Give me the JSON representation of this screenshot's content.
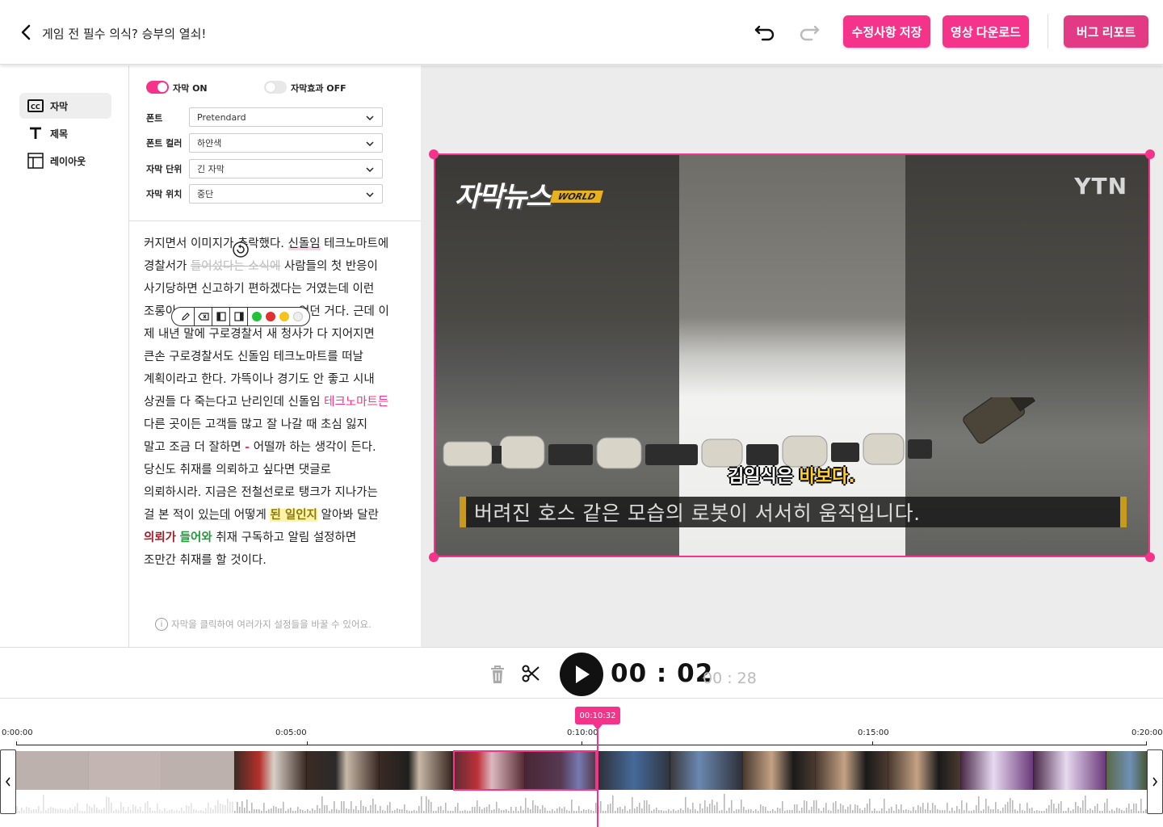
{
  "header": {
    "title": "게임 전 필수 의식? 승부의 열쇠!",
    "save_label": "수정사항 저장",
    "download_label": "영상 다운로드",
    "bug_label": "버그 리포트"
  },
  "sidebar": {
    "items": [
      {
        "label": "자막",
        "icon": "cc-icon"
      },
      {
        "label": "제목",
        "icon": "text-icon"
      },
      {
        "label": "레이아웃",
        "icon": "layout-icon"
      }
    ]
  },
  "settings": {
    "subtitle_toggle_label": "자막 ON",
    "effect_toggle_label": "자막효과 OFF",
    "font_label": "폰트",
    "font_value": "Pretendard",
    "color_label": "폰트 컬러",
    "color_value": "하얀색",
    "unit_label": "자막 단위",
    "unit_value": "긴 자막",
    "position_label": "자막 위치",
    "position_value": "중단"
  },
  "transcript": {
    "l1a": "커지면서 이미지가 추락했다. ",
    "l1b": "신돌임",
    "l1c": " 테크노마트에",
    "l2a": "경찰서가 ",
    "l2b": "들어섰다는 소식에",
    "l2c": " 사람들의 첫 반응이",
    "l3": "사기당하면 신고하기 편하겠다는 거였는데 이런",
    "l4a": "조롱이",
    "l4b": "었던 거다. 근데 이",
    "l5": "제 내년 말에 구로경찰서 새 청사가 다 지어지면",
    "l6": "큰손 구로경찰서도 신돌임 테크노마트를 떠날",
    "l7": "계획이라고 한다. 가뜩이나 경기도 안 좋고 시내",
    "l8a": "상권들 다 죽는다고 난리인데 신돌임 ",
    "l8b": "테크노마트든",
    "l9": "다른 곳이든 고객들 많고 잘 나갈 때 초심 잃지",
    "l10a": "말고 조금 더 잘하면 ",
    "l10b": "-",
    "l10c": " 어떨까 하는 생각이 든다.",
    "l11": "당신도 취재를 의뢰하고 싶다면 댓글로",
    "l12": "의뢰하시라. 지금은 전철선로로 탱크가 지나가는",
    "l13a": "걸 본 적이 ",
    "l13b": "있는데",
    "l13c": " 어떻게 ",
    "l13d": "된 일인지",
    "l13e": " 알아봐 달란",
    "l14a": "의뢰가",
    "l14b": " ",
    "l14c": "들어와",
    "l14d": " 취재 구독하고 알림 설정하면",
    "l15": "조만간 취재를 할 것이다.",
    "hint": "자막을 클릭하여 여러가지 설정들을 바꿀 수 있어요."
  },
  "video": {
    "logo_text": "자막뉴스",
    "logo_sub": "WORLD",
    "channel": "YTN",
    "subtitle_a": "김일식은 ",
    "subtitle_b": "바보다.",
    "caption": "버려진 호스 같은 모습의 로봇이 서서히 움직입니다."
  },
  "playback": {
    "current_time": "00 : 02",
    "total_time": "00 : 28"
  },
  "timeline": {
    "ticks": [
      "0:00:00",
      "0:05:00",
      "0:10:00",
      "0:15:00",
      "0:20:00"
    ],
    "playhead": "00:10:32"
  },
  "colors": {
    "accent": "#f5338a",
    "bug_button": "#e23a84"
  }
}
